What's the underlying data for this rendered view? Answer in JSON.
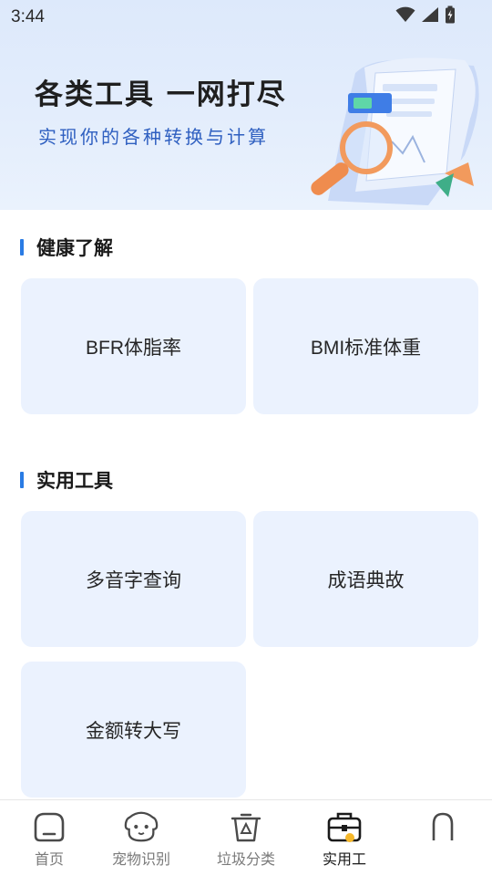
{
  "status_bar": {
    "time": "3:44"
  },
  "banner": {
    "title": "各类工具 一网打尽",
    "subtitle": "实现你的各种转换与计算"
  },
  "sections": [
    {
      "title": "健康了解",
      "cards": [
        {
          "label": "BFR体脂率"
        },
        {
          "label": "BMI标准体重"
        }
      ]
    },
    {
      "title": "实用工具",
      "cards": [
        {
          "label": "多音字查询"
        },
        {
          "label": "成语典故"
        },
        {
          "label": "金额转大写"
        }
      ]
    }
  ],
  "bottom_nav": {
    "items": [
      {
        "label": "首页",
        "icon": "home-icon",
        "active": false
      },
      {
        "label": "宠物识别",
        "icon": "pet-face-icon",
        "active": false
      },
      {
        "label": "垃圾分类",
        "icon": "trash-bin-icon",
        "active": false
      },
      {
        "label": "实用工",
        "icon": "toolbox-icon",
        "active": true
      },
      {
        "label": "",
        "icon": "profile-icon",
        "active": false
      }
    ]
  },
  "colors": {
    "accent": "#2a7be4",
    "card_bg": "#ebf2fe",
    "banner_bg": "#e3edfc",
    "subtitle": "#2e5fc0"
  }
}
